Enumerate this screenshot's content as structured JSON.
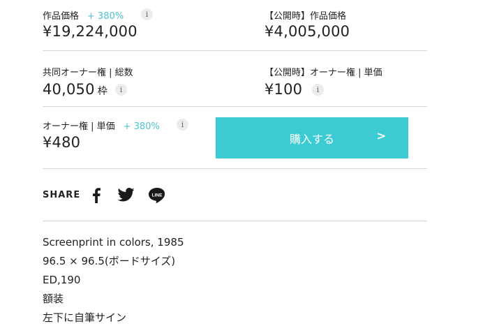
{
  "price_block": {
    "work_price_label": "作品価格",
    "work_price_change": "+ 380%",
    "work_price_value": "¥19,224,000",
    "public_work_price_label": "【公開時】作品価格",
    "public_work_price_value": "¥4,005,000",
    "total_shares_label": "共同オーナー権 | 総数",
    "total_shares_value": "40,050",
    "total_shares_unit": "枠",
    "public_unit_price_label": "【公開時】オーナー権 | 単価",
    "public_unit_price_value": "¥100",
    "unit_price_label": "オーナー権 | 単価",
    "unit_price_change": "+ 380%",
    "unit_price_value": "¥480",
    "info_glyph": "i"
  },
  "buy_button": {
    "label": "購入する",
    "arrow": ">",
    "color": "#3ccbd3"
  },
  "share": {
    "label": "SHARE",
    "icons": [
      "facebook-icon",
      "twitter-icon",
      "line-icon"
    ],
    "line_text": "LINE"
  },
  "description": {
    "lines": [
      "Screenprint in colors, 1985",
      "96.5 × 96.5(ボードサイズ)",
      "ED,190",
      "額装",
      "左下に自筆サイン"
    ]
  },
  "colors": {
    "accent": "#4ec3cf",
    "divider": "#d6d6d6"
  }
}
